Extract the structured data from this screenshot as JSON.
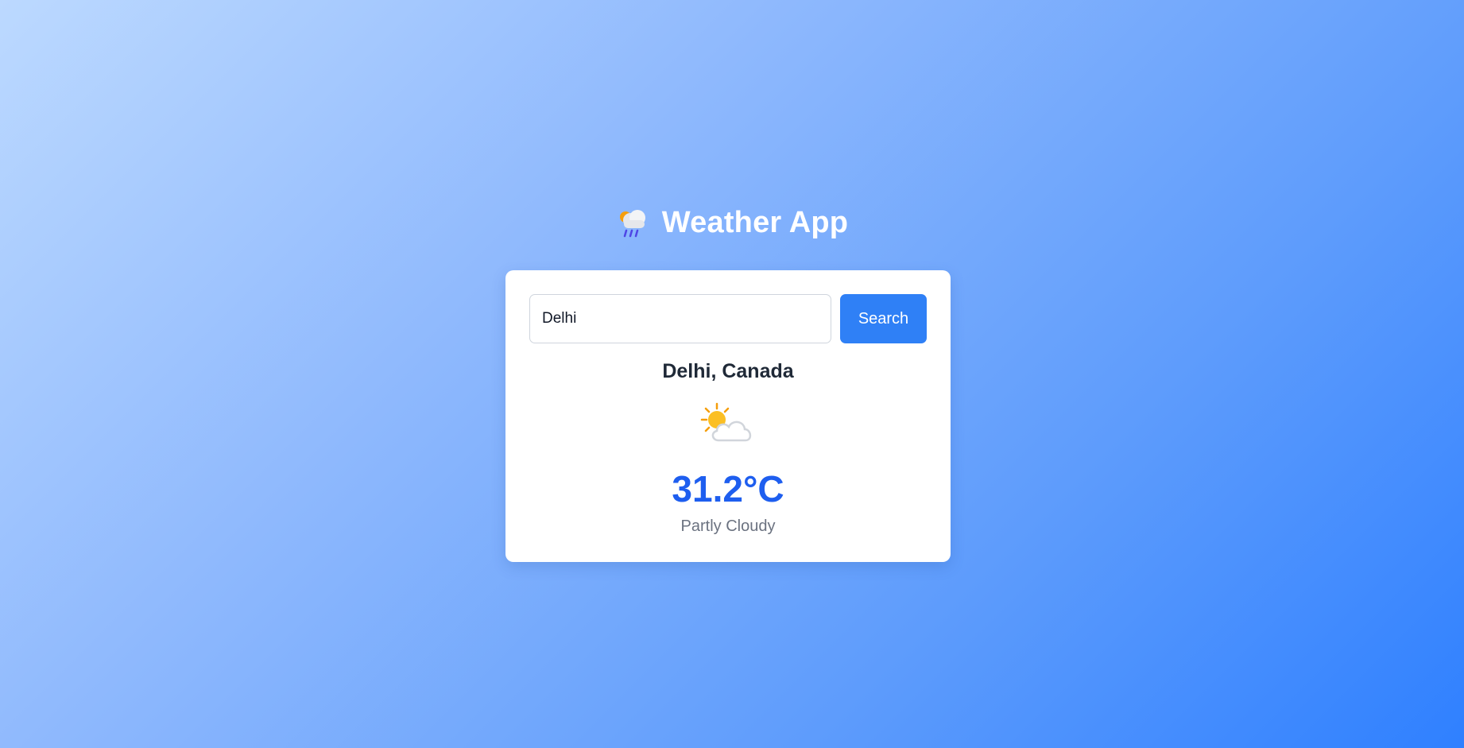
{
  "app": {
    "title": "Weather App",
    "title_icon": "rain-cloud-icon"
  },
  "search": {
    "value": "Delhi",
    "button_label": "Search"
  },
  "weather": {
    "location": "Delhi, Canada",
    "icon": "partly-cloudy-icon",
    "temperature": "31.2°C",
    "condition": "Partly Cloudy"
  },
  "colors": {
    "accent": "#2f80f6",
    "temperature": "#1e5eef",
    "background_start": "#bcd9ff",
    "background_end": "#2f80ff"
  }
}
